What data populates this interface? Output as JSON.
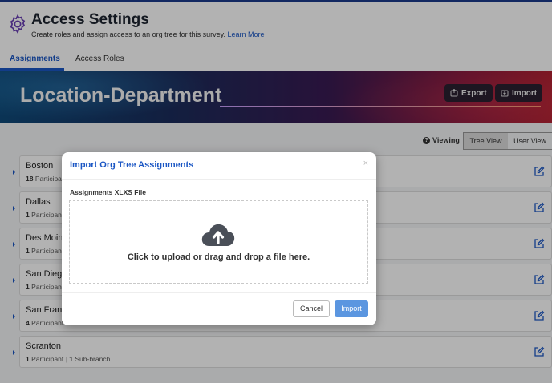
{
  "header": {
    "title": "Access Settings",
    "subtitle": "Create roles and assign access to an org tree for this survey.",
    "learn_more": "Learn More"
  },
  "tabs": [
    {
      "label": "Assignments",
      "active": true
    },
    {
      "label": "Access Roles",
      "active": false
    }
  ],
  "banner": {
    "title": "Location-Department",
    "export_label": "Export",
    "import_label": "Import"
  },
  "view_toggle": {
    "viewing_label": "Viewing",
    "help_glyph": "?",
    "tree_view": "Tree View",
    "user_view": "User View",
    "selected": "Tree View"
  },
  "rows": [
    {
      "name": "Boston",
      "count": "18",
      "count_label": "Participants",
      "extra": ""
    },
    {
      "name": "Dallas",
      "count": "1",
      "count_label": "Participant",
      "extra": ""
    },
    {
      "name": "Des Moines",
      "count": "1",
      "count_label": "Participant",
      "extra": ""
    },
    {
      "name": "San Diego",
      "count": "1",
      "count_label": "Participant",
      "extra": ""
    },
    {
      "name": "San Francisco",
      "count": "4",
      "count_label": "Participants",
      "extra": ""
    },
    {
      "name": "Scranton",
      "count": "1",
      "count_label": "Participant",
      "sep": "|",
      "sub_count": "1",
      "sub_label": "Sub-branch"
    }
  ],
  "modal": {
    "title": "Import Org Tree Assignments",
    "close_glyph": "×",
    "field_label": "Assignments XLXS File",
    "drop_text": "Click to upload or drag and drop a file here.",
    "cancel_label": "Cancel",
    "import_label": "Import"
  },
  "colors": {
    "accent": "#1a56c4",
    "primary_button": "#5b96e0"
  }
}
